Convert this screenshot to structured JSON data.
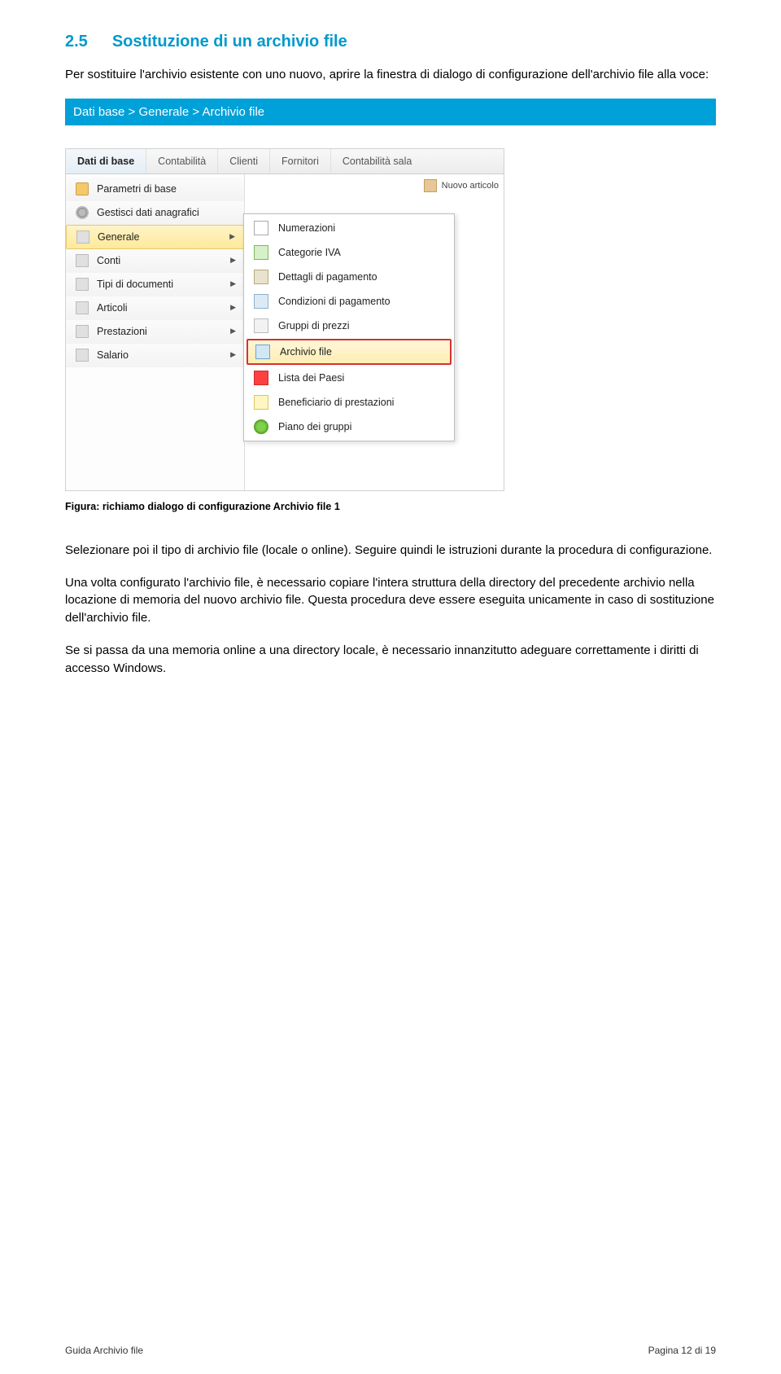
{
  "section": {
    "number": "2.5",
    "title": "Sostituzione di un archivio file"
  },
  "intro": "Per sostituire l'archivio esistente con uno nuovo, aprire la finestra di dialogo di configurazione dell'archivio file alla voce:",
  "path_bar": "Dati base > Generale > Archivio file",
  "menubar": {
    "tabs": [
      "Dati di base",
      "Contabilità",
      "Clienti",
      "Fornitori",
      "Contabilità sala"
    ]
  },
  "left_menu": {
    "items": [
      {
        "label": "Parametri di base",
        "arrow": false
      },
      {
        "label": "Gestisci dati anagrafici",
        "arrow": false
      },
      {
        "label": "Generale",
        "arrow": true,
        "selected": true
      },
      {
        "label": "Conti",
        "arrow": true
      },
      {
        "label": "Tipi di documenti",
        "arrow": true
      },
      {
        "label": "Articoli",
        "arrow": true
      },
      {
        "label": "Prestazioni",
        "arrow": true
      },
      {
        "label": "Salario",
        "arrow": true
      }
    ]
  },
  "sub_menu": {
    "items": [
      {
        "label": "Numerazioni",
        "icon": "ico-num"
      },
      {
        "label": "Categorie IVA",
        "icon": "ico-perc"
      },
      {
        "label": "Dettagli di pagamento",
        "icon": "ico-bank"
      },
      {
        "label": "Condizioni di pagamento",
        "icon": "ico-card"
      },
      {
        "label": "Gruppi di prezzi",
        "icon": "ico-list"
      },
      {
        "label": "Archivio file",
        "icon": "ico-disk",
        "highlight": true
      },
      {
        "label": "Lista dei Paesi",
        "icon": "ico-flag"
      },
      {
        "label": "Beneficiario di prestazioni",
        "icon": "ico-note"
      },
      {
        "label": "Piano dei gruppi",
        "icon": "ico-green"
      }
    ]
  },
  "corner_label": "Nuovo articolo",
  "caption": "Figura: richiamo dialogo di configurazione Archivio file 1",
  "para1": "Selezionare poi il tipo di archivio file (locale o online). Seguire quindi le istruzioni durante la procedura di configurazione.",
  "para2": "Una volta configurato l'archivio file, è necessario copiare l'intera struttura della directory del precedente archivio nella locazione di memoria del nuovo archivio file. Questa procedura deve essere eseguita unicamente in caso di sostituzione dell'archivio file.",
  "para3": "Se si passa da una memoria online a una directory locale, è necessario innanzitutto adeguare correttamente i diritti di accesso Windows.",
  "footer": {
    "left": "Guida Archivio file",
    "right": "Pagina 12 di 19"
  }
}
